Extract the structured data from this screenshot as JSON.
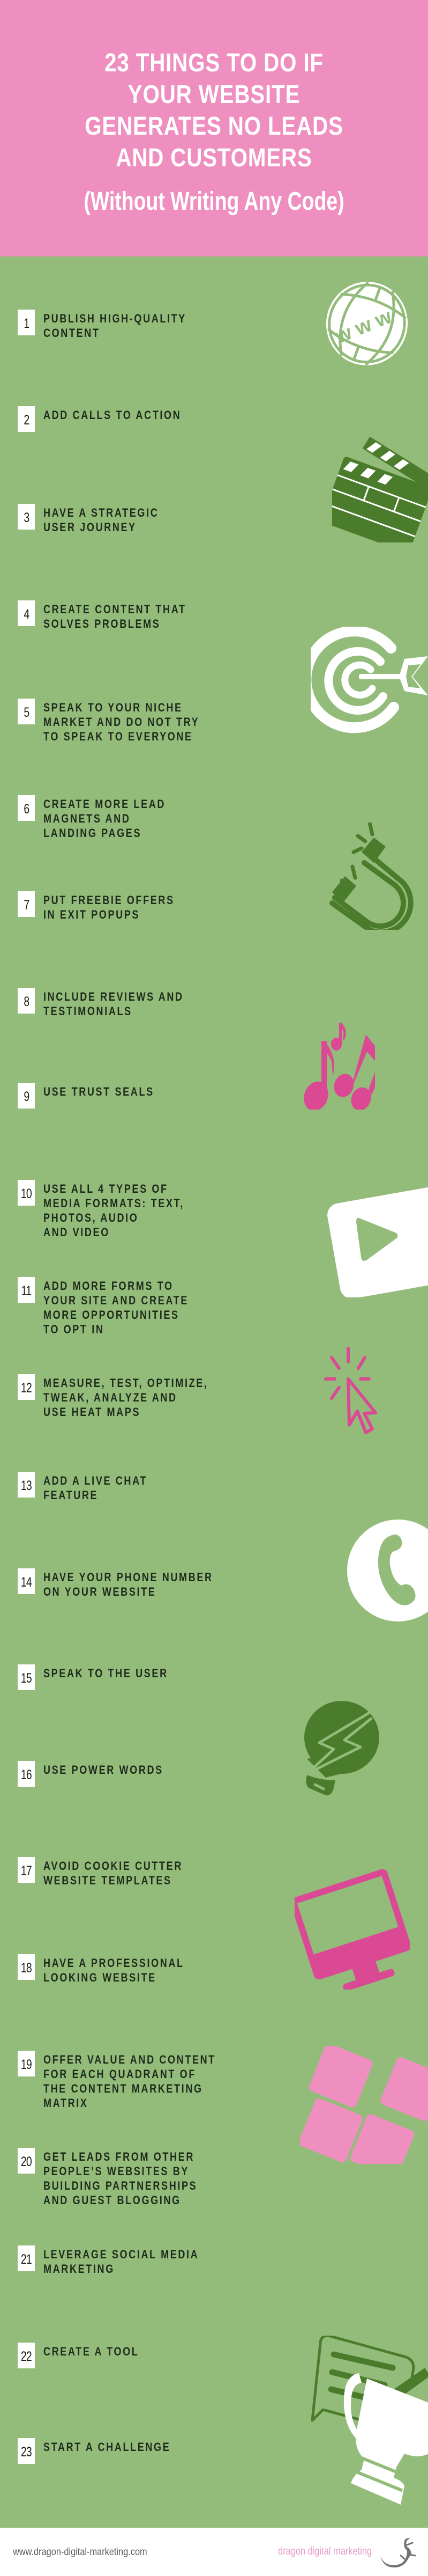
{
  "header": {
    "title_lines": [
      "23 THINGS TO DO IF",
      "YOUR WEBSITE",
      "GENERATES NO LEADS",
      "AND CUSTOMERS"
    ],
    "subtitle": "(Without Writing Any Code)"
  },
  "colors": {
    "header_bg": "#ee8fc0",
    "main_bg": "#93bc7a",
    "dark_green": "#4a7c2c",
    "magenta": "#db4894",
    "light_pink": "#ef8fc0",
    "text_dark": "#1f2a1c"
  },
  "items": [
    {
      "number": "1",
      "lines": [
        "PUBLISH HIGH-QUALITY",
        "CONTENT"
      ],
      "icon": "globe-www-icon"
    },
    {
      "number": "2",
      "lines": [
        "ADD CALLS TO ACTION"
      ],
      "icon": "clapperboard-icon"
    },
    {
      "number": "3",
      "lines": [
        "HAVE A STRATEGIC",
        "USER JOURNEY"
      ],
      "icon": ""
    },
    {
      "number": "4",
      "lines": [
        "CREATE CONTENT THAT",
        "SOLVES PROBLEMS"
      ],
      "icon": "target-icon"
    },
    {
      "number": "5",
      "lines": [
        "SPEAK TO YOUR NICHE",
        "MARKET AND DO NOT TRY",
        "TO SPEAK TO EVERYONE"
      ],
      "icon": ""
    },
    {
      "number": "6",
      "lines": [
        "CREATE MORE LEAD",
        "MAGNETS AND",
        "LANDING PAGES"
      ],
      "icon": "magnet-icon"
    },
    {
      "number": "7",
      "lines": [
        "PUT FREEBIE OFFERS",
        "IN EXIT POPUPS"
      ],
      "icon": ""
    },
    {
      "number": "8",
      "lines": [
        "INCLUDE REVIEWS AND",
        "TESTIMONIALS"
      ],
      "icon": "music-notes-icon"
    },
    {
      "number": "9",
      "lines": [
        "USE TRUST SEALS"
      ],
      "icon": ""
    },
    {
      "number": "10",
      "lines": [
        "USE ALL 4 TYPES OF",
        "MEDIA FORMATS: TEXT,",
        "PHOTOS, AUDIO",
        "AND VIDEO"
      ],
      "icon": "play-button-icon"
    },
    {
      "number": "11",
      "lines": [
        "ADD MORE FORMS TO",
        "YOUR SITE AND CREATE",
        "MORE OPPORTUNITIES",
        "TO OPT IN"
      ],
      "icon": "cursor-click-icon"
    },
    {
      "number": "12",
      "lines": [
        "MEASURE, TEST, OPTIMIZE,",
        "TWEAK, ANALYZE AND",
        "USE HEAT MAPS"
      ],
      "icon": ""
    },
    {
      "number": "13",
      "lines": [
        "ADD A LIVE CHAT",
        "FEATURE"
      ],
      "icon": "phone-icon"
    },
    {
      "number": "14",
      "lines": [
        "HAVE YOUR PHONE NUMBER",
        "ON YOUR WEBSITE"
      ],
      "icon": ""
    },
    {
      "number": "15",
      "lines": [
        "SPEAK TO THE USER"
      ],
      "icon": "lightbulb-icon"
    },
    {
      "number": "16",
      "lines": [
        "USE POWER WORDS"
      ],
      "icon": ""
    },
    {
      "number": "17",
      "lines": [
        "AVOID COOKIE CUTTER",
        "WEBSITE TEMPLATES"
      ],
      "icon": "monitor-icon"
    },
    {
      "number": "18",
      "lines": [
        "HAVE A PROFESSIONAL",
        "LOOKING WEBSITE"
      ],
      "icon": ""
    },
    {
      "number": "19",
      "lines": [
        "OFFER VALUE AND CONTENT",
        "FOR EACH QUADRANT OF",
        "THE CONTENT MARKETING",
        "MATRIX"
      ],
      "icon": "grid-squares-icon"
    },
    {
      "number": "20",
      "lines": [
        "GET LEADS FROM OTHER",
        "PEOPLE’S WEBSITES BY",
        "BUILDING PARTNERSHIPS",
        "AND GUEST BLOGGING"
      ],
      "icon": ""
    },
    {
      "number": "21",
      "lines": [
        "LEVERAGE SOCIAL MEDIA",
        "MARKETING"
      ],
      "icon": "chat-bubble-pen-icon"
    },
    {
      "number": "22",
      "lines": [
        "CREATE A TOOL"
      ],
      "icon": "trophy-icon"
    },
    {
      "number": "23",
      "lines": [
        "START A CHALLENGE"
      ],
      "icon": ""
    }
  ],
  "footer": {
    "url": "www.dragon-digital-marketing.com",
    "brand": "dragon digital marketing",
    "logo_icon": "lizard-logo-icon"
  }
}
